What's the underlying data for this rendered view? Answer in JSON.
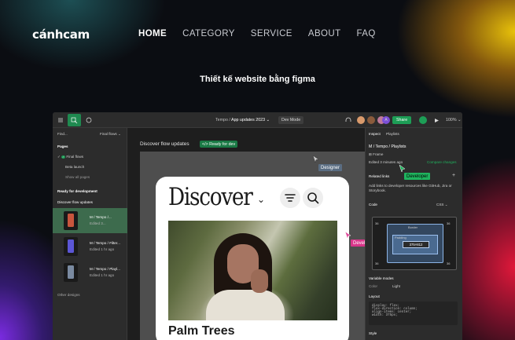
{
  "site": {
    "logo": "cánhcam",
    "nav": [
      "HOME",
      "CATEGORY",
      "SERVICE",
      "ABOUT",
      "FAQ"
    ],
    "active_nav": "HOME",
    "hero_title": "Thiết kế website bằng figma"
  },
  "figma": {
    "breadcrumb_project": "Tempo /",
    "breadcrumb_file": "App updates 2023 ⌄",
    "dev_mode": "Dev Mode",
    "share": "Share",
    "zoom": "100% ⌄",
    "find": "Find...",
    "final_flows": "Final flows ⌄",
    "pages_label": "Pages",
    "pages": [
      "Final flows",
      "Beta launch",
      "Show all pages"
    ],
    "ready_label": "Ready for development",
    "discover_flow": "Discover flow updates",
    "thumbs": [
      {
        "title": "M / Tempo /...",
        "sub": "Edited 3..."
      },
      {
        "title": "M / Tempo / Filter...",
        "sub": "Edited 1 hr ago"
      },
      {
        "title": "M / Tempo / Playl...",
        "sub": "Edited 1 hr ago"
      }
    ],
    "other_designs": "Other designs",
    "canvas_label": "Discover flow updates",
    "ready_tag": "</> Ready for dev",
    "phone_title": "Discover",
    "photo_title": "Palm Trees",
    "cursor_designer": "Designer",
    "cursor_developer": "Developer",
    "inspect_tab": "Inspect",
    "playlists_tab": "Playlists",
    "frame_path": "M / Tempo / Playlists",
    "frame_type": "Frame",
    "edited": "Edited 3 minutes ago",
    "compare": "Compare changes",
    "related": "Related links",
    "related_desc": "Add links to developer resources like GitHub, Jira or Storybook.",
    "code_label": "Code",
    "css_label": "CSS ⌄",
    "bm_border": "Border",
    "bm_padding": "Padding",
    "bm_content": "375×812",
    "bm_num": "36",
    "variable_modes": "Variable modes",
    "color": "Color",
    "light": "Light",
    "layout": "Layout",
    "code_lines": [
      "display: flex;",
      "flex-direction: column;",
      "align-items: center;",
      "width: 375px;"
    ],
    "style": "Style"
  }
}
